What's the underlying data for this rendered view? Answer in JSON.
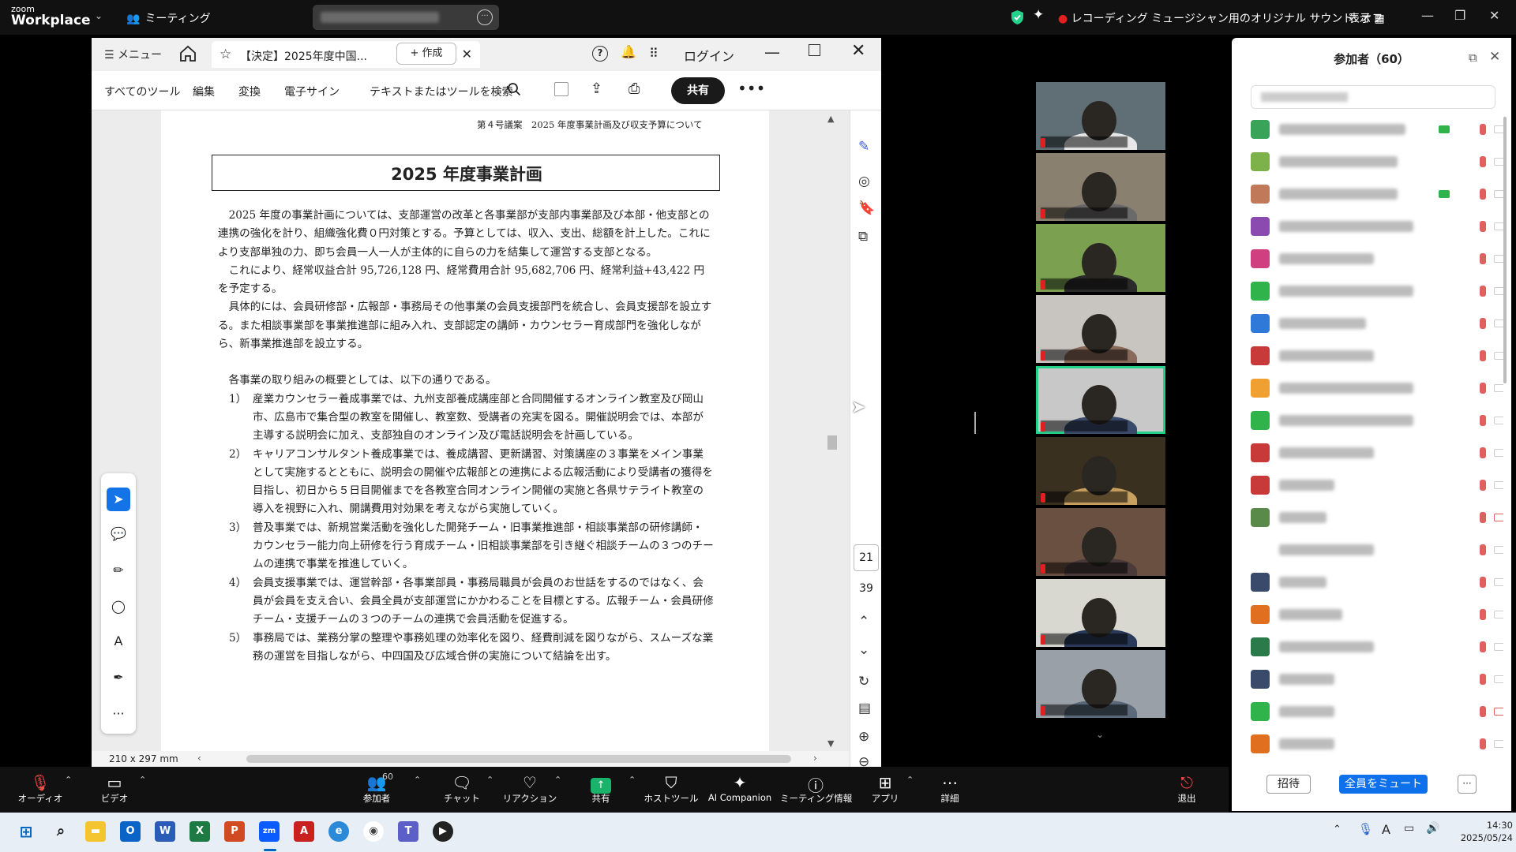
{
  "zoom": {
    "logo_top": "zoom",
    "logo_bottom": "Workplace",
    "meeting_label": "ミーティング",
    "recording_status": "レコーディング",
    "original_sound": "ミュージシャン用のオリジナル サウンド: オフ",
    "view_label": "表示",
    "colors": {
      "accent": "#0e71eb",
      "active_speaker": "#23d18b",
      "share_green": "#19b36b"
    }
  },
  "acrobat": {
    "menu_label": "メニュー",
    "tab_title": "【決定】2025年度中国...",
    "create_label": "作成",
    "login_label": "ログイン",
    "toolbar": {
      "all_tools": "すべてのツール",
      "edit": "編集",
      "convert": "変換",
      "esign": "電子サイン",
      "search_placeholder": "テキストまたはツールを検索",
      "share": "共有"
    },
    "page_size": "210 x 297 mm",
    "page_current": "21",
    "page_total": "39"
  },
  "document": {
    "header": "第４号議案　2025 年度事業計画及び収支予算について",
    "title": "2025 年度事業計画",
    "para1": "2025 年度の事業計画については、支部運営の改革と各事業部が支部内事業部及び本部・他支部との連携の強化を計り、組織強化費０円対策とする。予算としては、収入、支出、総額を計上した。これにより支部単独の力、即ち会員一人一人が主体的に自らの力を結集して運営する支部となる。",
    "para2": "これにより、経常収益合計 95,726,128 円、経常費用合計 95,682,706 円、経常利益+43,422 円を予定する。",
    "para3": "具体的には、会員研修部・広報部・事務局その他事業の会員支援部門を統合し、会員支援部を設立する。また相談事業部を事業推進部に組み入れ、支部認定の講師・カウンセラー育成部門を強化しながら、新事業推進部を設立する。",
    "intro": "各事業の取り組みの概要としては、以下の通りである。",
    "items": [
      {
        "num": "1）",
        "text": "産業カウンセラー養成事業では、九州支部養成講座部と合同開催するオンライン教室及び岡山市、広島市で集合型の教室を開催し、教室数、受講者の充実を図る。開催説明会では、本部が主導する説明会に加え、支部独自のオンライン及び電話説明会を計画している。"
      },
      {
        "num": "2）",
        "text": "キャリアコンサルタント養成事業では、養成講習、更新講習、対策講座の３事業をメイン事業として実施するとともに、説明会の開催や広報部との連携による広報活動により受講者の獲得を目指し、初日から５日目開催までを各教室合同オンライン開催の実施と各県サテライト教室の導入を視野に入れ、開講費用対効果を考えながら実施していく。"
      },
      {
        "num": "3）",
        "text": "普及事業では、新規営業活動を強化した開発チーム・旧事業推進部・相談事業部の研修講師・カウンセラー能力向上研修を行う育成チーム・旧相談事業部を引き継ぐ相談チームの３つのチームの連携で事業を推進していく。"
      },
      {
        "num": "4）",
        "text": "会員支援事業では、運営幹部・各事業部員・事務局職員が会員のお世話をするのではなく、会員が会員を支え合い、会員全員が支部運営にかかわることを目標とする。広報チーム・会員研修チーム・支援チームの３つのチームの連携で会員活動を促進する。"
      },
      {
        "num": "5）",
        "text": "事務局では、業務分掌の整理や事務処理の効率化を図り、経費削減を図りながら、スムーズな業務の運営を目指しながら、中四国及び広域合併の実施について結論を出す。"
      }
    ]
  },
  "participants_panel": {
    "title": "参加者（60）",
    "invite": "招待",
    "mute_all": "全員をミュート",
    "rows": [
      {
        "color": "#3aa35a",
        "w": 160,
        "video": true,
        "cam_off": false
      },
      {
        "color": "#7db24a",
        "w": 150,
        "video": false,
        "cam_off": false
      },
      {
        "color": "#c07a5a",
        "w": 150,
        "video": true,
        "cam_off": false
      },
      {
        "color": "#8a4ab0",
        "w": 170,
        "video": false,
        "cam_off": false
      },
      {
        "color": "#d04080",
        "w": 120,
        "video": false,
        "cam_off": false
      },
      {
        "color": "#2fb34a",
        "w": 170,
        "video": false,
        "cam_off": false
      },
      {
        "color": "#2f7ad8",
        "w": 110,
        "video": false,
        "cam_off": false
      },
      {
        "color": "#c83a3a",
        "w": 120,
        "video": false,
        "cam_off": false
      },
      {
        "color": "#f0a030",
        "w": 170,
        "video": false,
        "cam_off": false
      },
      {
        "color": "#2fb34a",
        "w": 170,
        "video": false,
        "cam_off": false
      },
      {
        "color": "#c83a3a",
        "w": 120,
        "video": false,
        "cam_off": false
      },
      {
        "color": "#c83a3a",
        "w": 70,
        "video": false,
        "cam_off": false
      },
      {
        "color": "#5a8a4a",
        "w": 60,
        "video": false,
        "cam_off": true
      },
      {
        "color": "#ffffff",
        "w": 120,
        "video": false,
        "cam_off": false
      },
      {
        "color": "#3a4a6a",
        "w": 60,
        "video": false,
        "cam_off": false
      },
      {
        "color": "#e07020",
        "w": 80,
        "video": false,
        "cam_off": false
      },
      {
        "color": "#2a7a4a",
        "w": 120,
        "video": false,
        "cam_off": false
      },
      {
        "color": "#3a4a6a",
        "w": 70,
        "video": false,
        "cam_off": false
      },
      {
        "color": "#2fb34a",
        "w": 70,
        "video": false,
        "cam_off": true
      },
      {
        "color": "#e07020",
        "w": 70,
        "video": false,
        "cam_off": false
      }
    ]
  },
  "video_tiles": [
    {
      "bg": "#5f6f75",
      "shirt": "#e8e8e8",
      "active": false
    },
    {
      "bg": "#8a8070",
      "shirt": "#6a6a6a",
      "active": false
    },
    {
      "bg": "#7aa050",
      "shirt": "#2a2a2a",
      "active": false
    },
    {
      "bg": "#c8c4c0",
      "shirt": "#8a6a5a",
      "active": false
    },
    {
      "bg": "#c8c8c8",
      "shirt": "#3a4a6a",
      "active": true
    },
    {
      "bg": "#3a3020",
      "shirt": "#c8a060",
      "active": false
    },
    {
      "bg": "#6a5040",
      "shirt": "#4a3a3a",
      "active": false
    },
    {
      "bg": "#d8d8d0",
      "shirt": "#2a3a5a",
      "active": false
    },
    {
      "bg": "#9aa0a8",
      "shirt": "#5a6a7a",
      "active": false
    }
  ],
  "zoom_toolbar": {
    "audio": "オーディオ",
    "video": "ビデオ",
    "participants": "参加者",
    "participants_count": "60",
    "chat": "チャット",
    "reactions": "リアクション",
    "share": "共有",
    "host_tools": "ホストツール",
    "ai_companion": "AI Companion",
    "meeting_info": "ミーティング情報",
    "apps": "アプリ",
    "more": "詳細",
    "leave": "退出"
  },
  "taskbar": {
    "time": "14:30",
    "date": "2025/05/24",
    "ime": "A"
  }
}
